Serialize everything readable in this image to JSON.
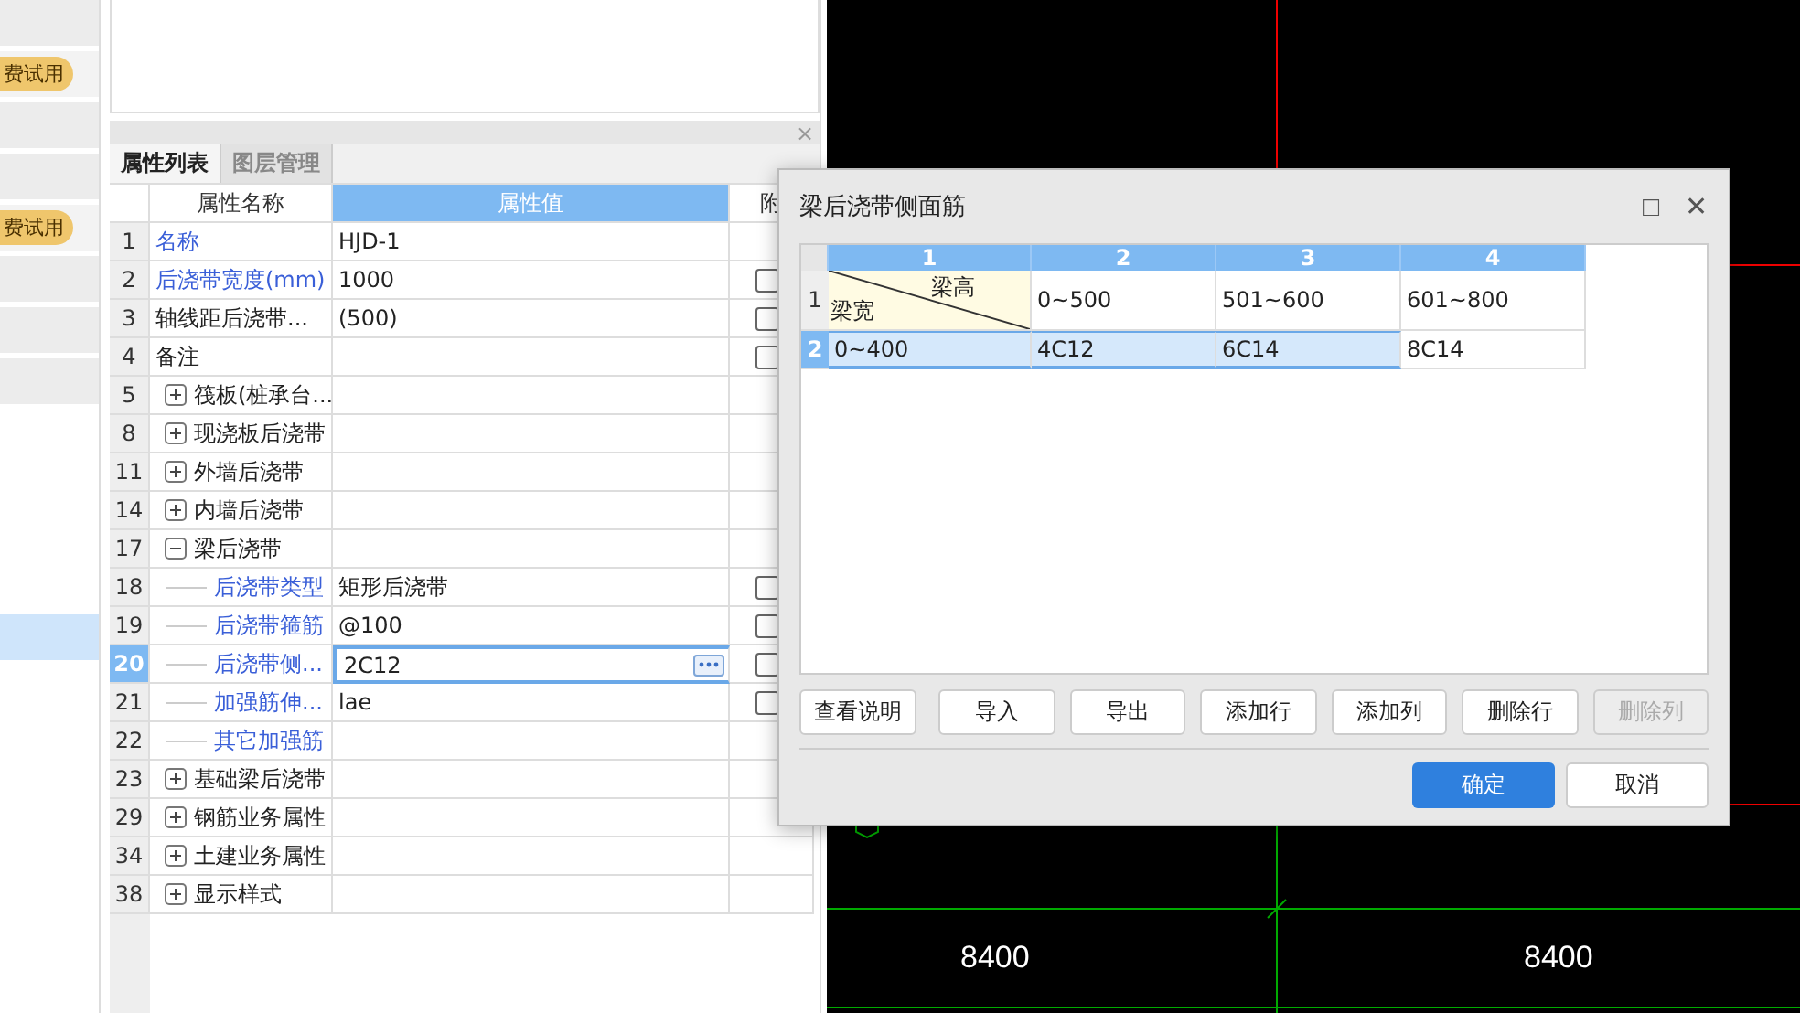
{
  "sidebar": {
    "items": [
      {
        "kind": "tile",
        "selected": false
      },
      {
        "kind": "badge",
        "label": "费试用",
        "selected": false
      },
      {
        "kind": "tile",
        "selected": false
      },
      {
        "kind": "tile",
        "selected": false
      },
      {
        "kind": "badge",
        "label": "费试用",
        "selected": false
      },
      {
        "kind": "tile",
        "selected": false
      },
      {
        "kind": "tile",
        "selected": false
      },
      {
        "kind": "tile",
        "selected": false
      },
      {
        "kind": "empty",
        "selected": false
      },
      {
        "kind": "empty",
        "selected": false
      },
      {
        "kind": "empty",
        "selected": false
      },
      {
        "kind": "empty",
        "selected": false
      },
      {
        "kind": "empty",
        "selected": true
      }
    ]
  },
  "properties": {
    "close": "×",
    "tabs": [
      {
        "label": "属性列表",
        "selected": true
      },
      {
        "label": "图层管理",
        "selected": false
      }
    ],
    "columns": [
      "属性名称",
      "属性值",
      "附"
    ],
    "rows": [
      {
        "num": "1",
        "name": "名称",
        "value": "HJD-1",
        "emphasis": true,
        "selected": false
      },
      {
        "num": "2",
        "name": "后浇带宽度(mm)",
        "value": "1000",
        "emphasis": true,
        "checked": false,
        "selected": false
      },
      {
        "num": "3",
        "name": "轴线距后浇带...",
        "value": "(500)",
        "emphasis": false,
        "checked": false,
        "selected": false
      },
      {
        "num": "4",
        "name": "备注",
        "emphasis": false,
        "checked": false,
        "selected": false
      },
      {
        "num": "5",
        "name": "筏板(桩承台...",
        "emphasis": false,
        "expanded": false,
        "selected": false
      },
      {
        "num": "8",
        "name": "现浇板后浇带",
        "emphasis": false,
        "expanded": false,
        "selected": false
      },
      {
        "num": "11",
        "name": "外墙后浇带",
        "emphasis": false,
        "expanded": false,
        "selected": false
      },
      {
        "num": "14",
        "name": "内墙后浇带",
        "emphasis": false,
        "expanded": false,
        "selected": false
      },
      {
        "num": "17",
        "name": "梁后浇带",
        "emphasis": false,
        "expanded": true,
        "selected": false,
        "children": [
          {
            "num": "18",
            "name": "后浇带类型",
            "value": "矩形后浇带",
            "emphasis": true,
            "checked": false,
            "selected": false
          },
          {
            "num": "19",
            "name": "后浇带箍筋",
            "value": "@100",
            "emphasis": true,
            "checked": false,
            "selected": false
          },
          {
            "num": "20",
            "name": "后浇带侧...",
            "value": "2C12",
            "emphasis": true,
            "checked": false,
            "selected": true
          },
          {
            "num": "21",
            "name": "加强筋伸...",
            "value": "lae",
            "emphasis": true,
            "checked": false,
            "selected": false
          },
          {
            "num": "22",
            "name": "其它加强筋",
            "emphasis": true,
            "selected": false
          }
        ]
      },
      {
        "num": "23",
        "name": "基础梁后浇带",
        "emphasis": false,
        "expanded": false,
        "selected": false
      },
      {
        "num": "29",
        "name": "钢筋业务属性",
        "emphasis": false,
        "expanded": false,
        "selected": false
      },
      {
        "num": "34",
        "name": "土建业务属性",
        "emphasis": false,
        "expanded": false,
        "selected": false
      },
      {
        "num": "38",
        "name": "显示样式",
        "emphasis": false,
        "expanded": false,
        "selected": false
      }
    ]
  },
  "canvas": {
    "labels": [
      "8400",
      "8400"
    ]
  },
  "dialog": {
    "title": "梁后浇带侧面筋",
    "maximize": "□",
    "close": "✕",
    "columns": [
      "1",
      "2",
      "3",
      "4"
    ],
    "header_row": {
      "num": "1",
      "corner_top": "梁高",
      "corner_bottom": "梁宽",
      "cells": [
        "0~500",
        "501~600",
        "601~800"
      ],
      "selected": false
    },
    "rows": [
      {
        "num": "2",
        "cells": [
          "0~400",
          "4C12",
          "6C14",
          "8C14"
        ],
        "selected": true
      }
    ],
    "buttons": [
      {
        "label": "查看说明",
        "disabled": false
      },
      {
        "label": "导入",
        "disabled": false
      },
      {
        "label": "导出",
        "disabled": false
      },
      {
        "label": "添加行",
        "disabled": false
      },
      {
        "label": "添加列",
        "disabled": false
      },
      {
        "label": "删除行",
        "disabled": false
      },
      {
        "label": "删除列",
        "disabled": true
      }
    ],
    "ok": "确定",
    "cancel": "取消"
  }
}
